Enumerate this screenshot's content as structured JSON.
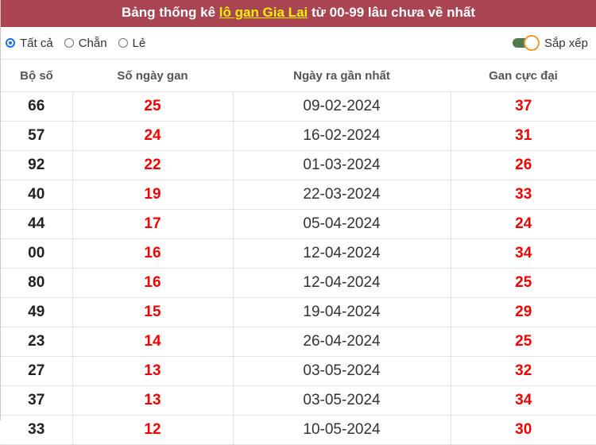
{
  "title": {
    "prefix": "Bảng thống kê ",
    "highlight": "lô gan Gia Lai",
    "suffix": " từ 00-99 lâu chưa về nhất"
  },
  "filters": {
    "options": [
      {
        "label": "Tất cả",
        "selected": true
      },
      {
        "label": "Chẵn",
        "selected": false
      },
      {
        "label": "Lẻ",
        "selected": false
      }
    ],
    "sort_label": "Sắp xếp",
    "sort_on": true
  },
  "colors": {
    "header_bg": "#a94452",
    "highlight": "#f2f200",
    "value_red": "#f20000",
    "toggle_track": "#4e7a4e",
    "toggle_knob_border": "#f39b2f",
    "radio_selected": "#1a73e8"
  },
  "table": {
    "headers": [
      "Bộ số",
      "Số ngày gan",
      "Ngày ra gần nhất",
      "Gan cực đại"
    ],
    "rows": [
      {
        "bo_so": "66",
        "so_ngay_gan": "25",
        "ngay_ra": "09-02-2024",
        "gan_cuc_dai": "37"
      },
      {
        "bo_so": "57",
        "so_ngay_gan": "24",
        "ngay_ra": "16-02-2024",
        "gan_cuc_dai": "31"
      },
      {
        "bo_so": "92",
        "so_ngay_gan": "22",
        "ngay_ra": "01-03-2024",
        "gan_cuc_dai": "26"
      },
      {
        "bo_so": "40",
        "so_ngay_gan": "19",
        "ngay_ra": "22-03-2024",
        "gan_cuc_dai": "33"
      },
      {
        "bo_so": "44",
        "so_ngay_gan": "17",
        "ngay_ra": "05-04-2024",
        "gan_cuc_dai": "24"
      },
      {
        "bo_so": "00",
        "so_ngay_gan": "16",
        "ngay_ra": "12-04-2024",
        "gan_cuc_dai": "34"
      },
      {
        "bo_so": "80",
        "so_ngay_gan": "16",
        "ngay_ra": "12-04-2024",
        "gan_cuc_dai": "25"
      },
      {
        "bo_so": "49",
        "so_ngay_gan": "15",
        "ngay_ra": "19-04-2024",
        "gan_cuc_dai": "29"
      },
      {
        "bo_so": "23",
        "so_ngay_gan": "14",
        "ngay_ra": "26-04-2024",
        "gan_cuc_dai": "25"
      },
      {
        "bo_so": "27",
        "so_ngay_gan": "13",
        "ngay_ra": "03-05-2024",
        "gan_cuc_dai": "32"
      },
      {
        "bo_so": "37",
        "so_ngay_gan": "13",
        "ngay_ra": "03-05-2024",
        "gan_cuc_dai": "34"
      },
      {
        "bo_so": "33",
        "so_ngay_gan": "12",
        "ngay_ra": "10-05-2024",
        "gan_cuc_dai": "30"
      }
    ]
  }
}
